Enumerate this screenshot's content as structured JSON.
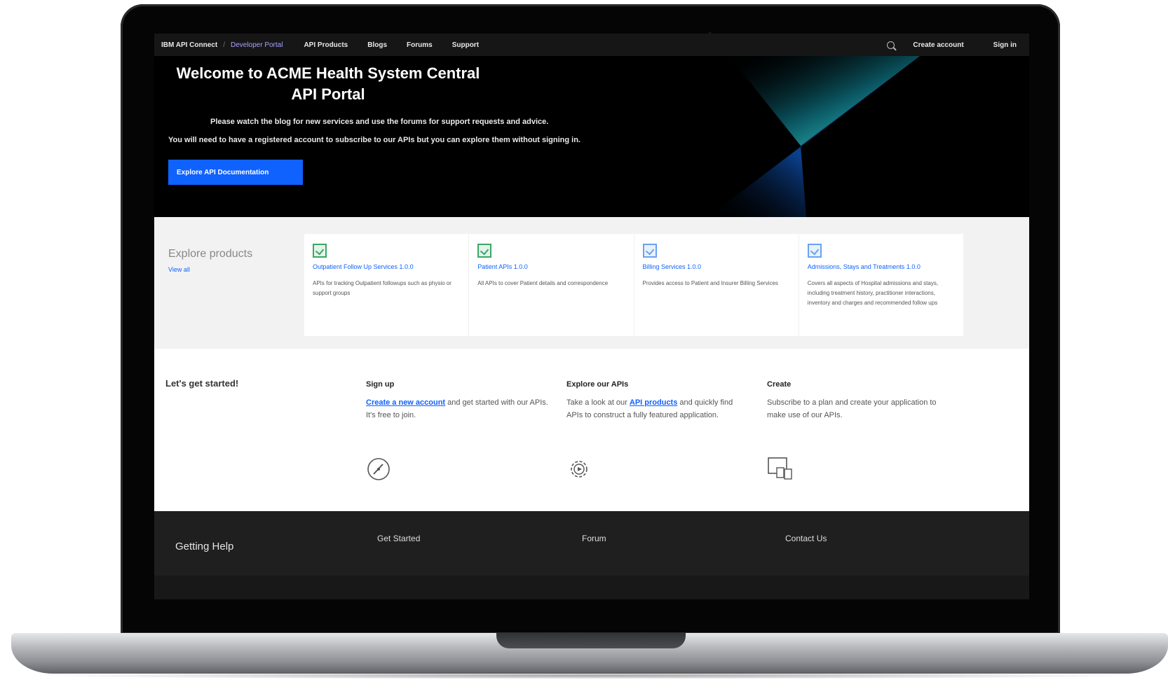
{
  "nav": {
    "brand": "IBM API Connect",
    "separator": "/",
    "portal": "Developer Portal",
    "links": [
      "API Products",
      "Blogs",
      "Forums",
      "Support"
    ],
    "create_account": "Create account",
    "sign_in": "Sign in"
  },
  "hero": {
    "title_line1": "Welcome to ACME Health System Central",
    "title_line2": "API Portal",
    "line1": "Please watch the blog for new services and use the forums for support requests and advice.",
    "line2": "You will need to have a registered account to subscribe to our APIs but you can explore them without signing in.",
    "button": "Explore API Documentation"
  },
  "products": {
    "title": "Explore products",
    "view_all": "View all",
    "cards": [
      {
        "name": "Outpatient Follow Up Services 1.0.0",
        "desc": "APIs for tracking Outpatient followups such as physio or support groups"
      },
      {
        "name": "Patient APIs 1.0.0",
        "desc": "All APIs to cover Patient details and correspondence"
      },
      {
        "name": "Billing Services 1.0.0",
        "desc": "Provides access to Patient and Insurer Billing Services"
      },
      {
        "name": "Admissions, Stays and Treatments 1.0.0",
        "desc": "Covers all aspects of Hospital admissions and stays, including treatment history, practitioner interactions, inventory and charges and recommended follow ups"
      }
    ]
  },
  "started": {
    "title": "Let's get started!",
    "signup": {
      "head": "Sign up",
      "link": "Create a new account",
      "text": " and get started with our APIs. It's free to join."
    },
    "explore": {
      "head": "Explore our APIs",
      "pre": "Take a look at our ",
      "link": "API products",
      "post": " and quickly find APIs to construct a fully featured application."
    },
    "create": {
      "head": "Create",
      "text": "Subscribe to a plan and create your application to make use of our APIs."
    }
  },
  "footer": {
    "title": "Getting Help",
    "links": [
      "Get Started",
      "Forum",
      "Contact Us"
    ]
  }
}
